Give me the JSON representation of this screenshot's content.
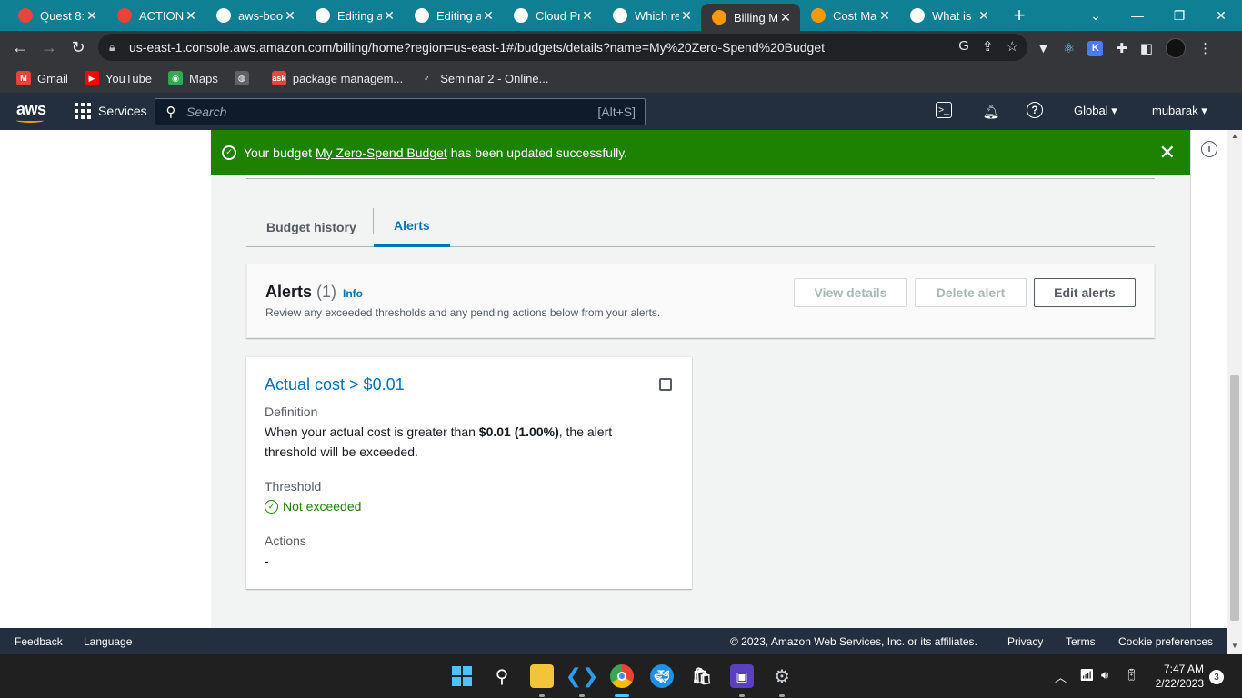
{
  "browser": {
    "tabs": [
      {
        "title": "Quest 8:",
        "icon": "quest-icon",
        "color": "#e8453c"
      },
      {
        "title": "ACTION",
        "icon": "gmail-icon",
        "color": "#ea4335"
      },
      {
        "title": "aws-boo",
        "icon": "github-icon",
        "color": "#ffffff"
      },
      {
        "title": "Editing a",
        "icon": "github-icon",
        "color": "#ffffff"
      },
      {
        "title": "Editing a",
        "icon": "github-icon",
        "color": "#ffffff"
      },
      {
        "title": "Cloud Pr",
        "icon": "globe-icon",
        "color": "#ffffff"
      },
      {
        "title": "Which re",
        "icon": "google-icon",
        "color": "#ffffff"
      },
      {
        "title": "Billing M",
        "icon": "aws-cube-icon",
        "color": "#ff9900",
        "active": true
      },
      {
        "title": "Cost Ma",
        "icon": "aws-cube-icon",
        "color": "#ff9900"
      },
      {
        "title": "What is",
        "icon": "google-icon",
        "color": "#ffffff"
      }
    ],
    "url": "us-east-1.console.aws.amazon.com/billing/home?region=us-east-1#/budgets/details?name=My%20Zero-Spend%20Budget",
    "bookmarks": [
      {
        "label": "Gmail",
        "color": "#ea4335",
        "glyph": "M"
      },
      {
        "label": "YouTube",
        "color": "#ff0000",
        "glyph": "▶"
      },
      {
        "label": "Maps",
        "color": "#34a853",
        "glyph": "◉"
      },
      {
        "label": "",
        "color": "#5f6368",
        "glyph": "◍"
      },
      {
        "label": "package managem...",
        "color": "#e8453c",
        "glyph": "ask"
      },
      {
        "label": "Seminar 2 - Online...",
        "color": "#35363a",
        "glyph": "♂"
      }
    ]
  },
  "aws": {
    "logo": "aws",
    "services": "Services",
    "search_placeholder": "Search",
    "search_shortcut": "[Alt+S]",
    "region": "Global ▾",
    "user": "mubarak ▾"
  },
  "flash": {
    "prefix": "Your budget",
    "link": "My Zero-Spend Budget",
    "suffix": "has been updated successfully."
  },
  "tabs": {
    "history": "Budget history",
    "alerts": "Alerts"
  },
  "alerts_header": {
    "title": "Alerts",
    "count": "(1)",
    "info": "Info",
    "description": "Review any exceeded thresholds and any pending actions below from your alerts.",
    "view_details": "View details",
    "delete_alert": "Delete alert",
    "edit_alerts": "Edit alerts"
  },
  "alert_card": {
    "title": "Actual cost > $0.01",
    "definition_label": "Definition",
    "definition_pre": "When your actual cost is greater than",
    "definition_value": "$0.01 (1.00%)",
    "definition_post": ", the alert threshold will be exceeded.",
    "threshold_label": "Threshold",
    "threshold_status": "Not exceeded",
    "actions_label": "Actions",
    "actions_value": "-"
  },
  "footer": {
    "feedback": "Feedback",
    "language": "Language",
    "copyright": "© 2023, Amazon Web Services, Inc. or its affiliates.",
    "privacy": "Privacy",
    "terms": "Terms",
    "cookies": "Cookie preferences"
  },
  "taskbar": {
    "time": "7:47 AM",
    "date": "2/22/2023",
    "notifications": "3"
  }
}
